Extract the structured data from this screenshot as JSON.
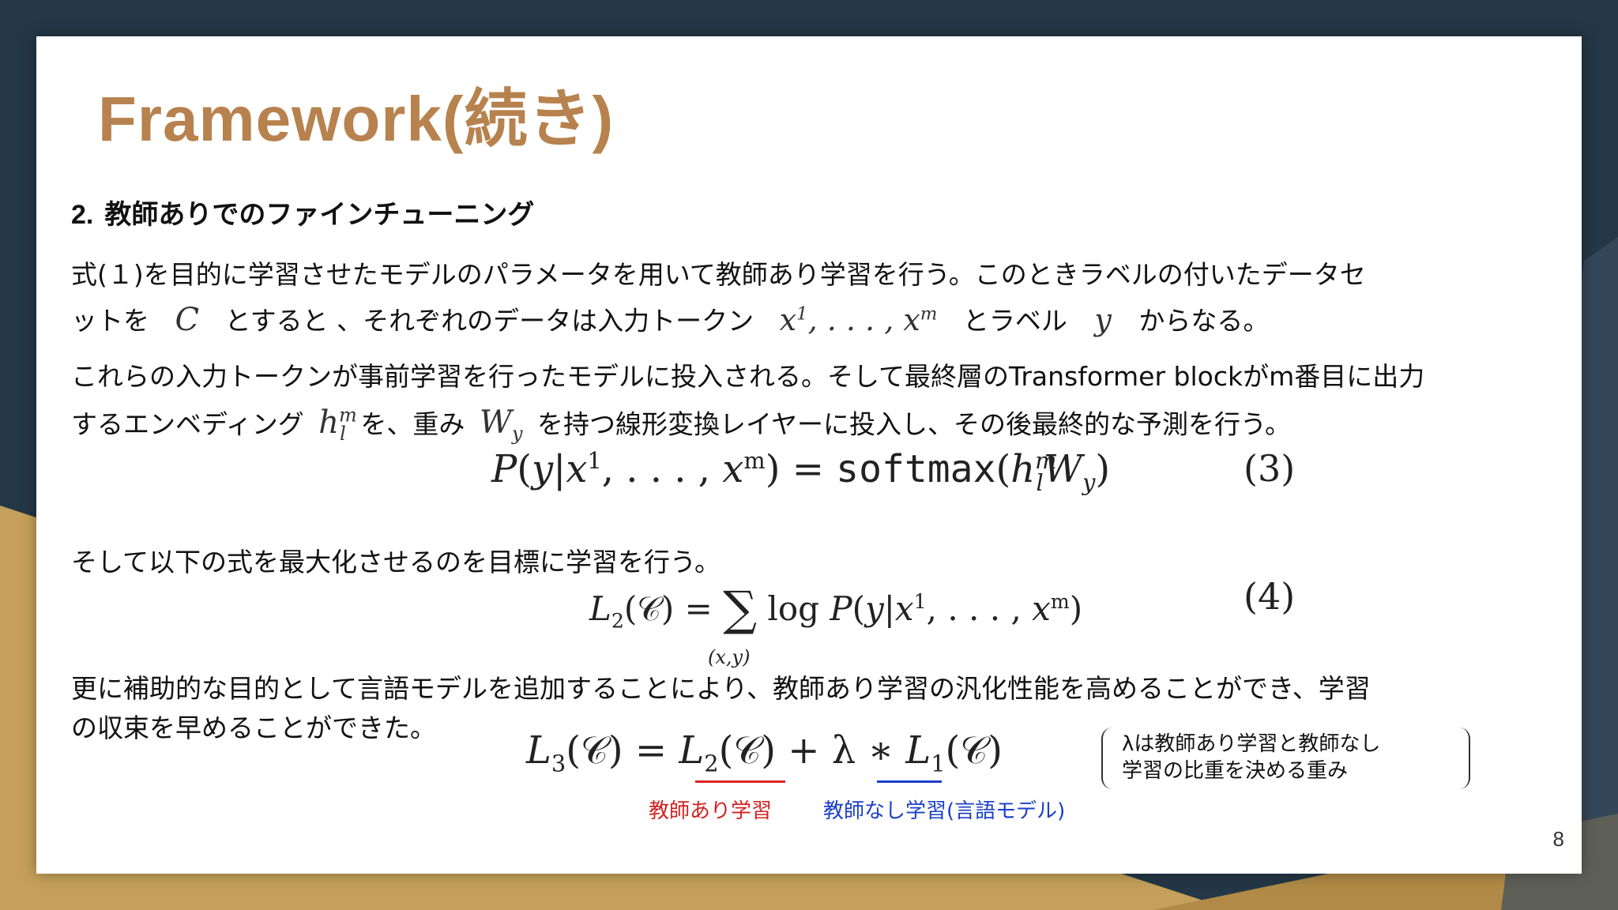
{
  "slide": {
    "title": "Framework(続き)",
    "heading_number": "2.",
    "heading_text": "教師ありでのファインチューニング",
    "para1_line1": "式(１)を目的に学習させたモデルのパラメータを用いて教師あり学習を行う。このときラベルの付いたデータセ",
    "para1_line2_a": "ットを",
    "para1_line2_b": "とすると 、それぞれのデータは入力トークン",
    "para1_line2_c": "とラベル",
    "para1_line2_d": "からなる。",
    "sym_C": "C",
    "sym_tokens": "x",
    "sym_y": "y",
    "para2_line1": "これらの入力トークンが事前学習を行ったモデルに投入される。そして最終層のTransformer blockがm番目に出力",
    "para2_line2_a": "するエンベディング",
    "para2_line2_b": "を、重み",
    "para2_line2_c": "を持つ線形変換レイヤーに投入し、その後最終的な予測を行う。",
    "eq3_number": "(3)",
    "para3": "そして以下の式を最大化させるのを目標に学習を行う。",
    "eq4_number": "(4)",
    "para4_line1": "更に補助的な目的として言語モデルを追加することにより、教師あり学習の汎化性能を高めることができ、学習",
    "para4_line2": "の収束を早めることができた。",
    "label_supervised": "教師あり学習",
    "label_unsupervised": "教師なし学習(言語モデル)",
    "note_line1": "λは教師あり学習と教師なし",
    "note_line2": "学習の比重を決める重み",
    "page_number": "8"
  },
  "colors": {
    "title": "#b7824e",
    "supervised": "#d22222",
    "unsupervised": "#1a3fc8",
    "background_dark": "#243746",
    "background_gold": "#c4a05a"
  }
}
